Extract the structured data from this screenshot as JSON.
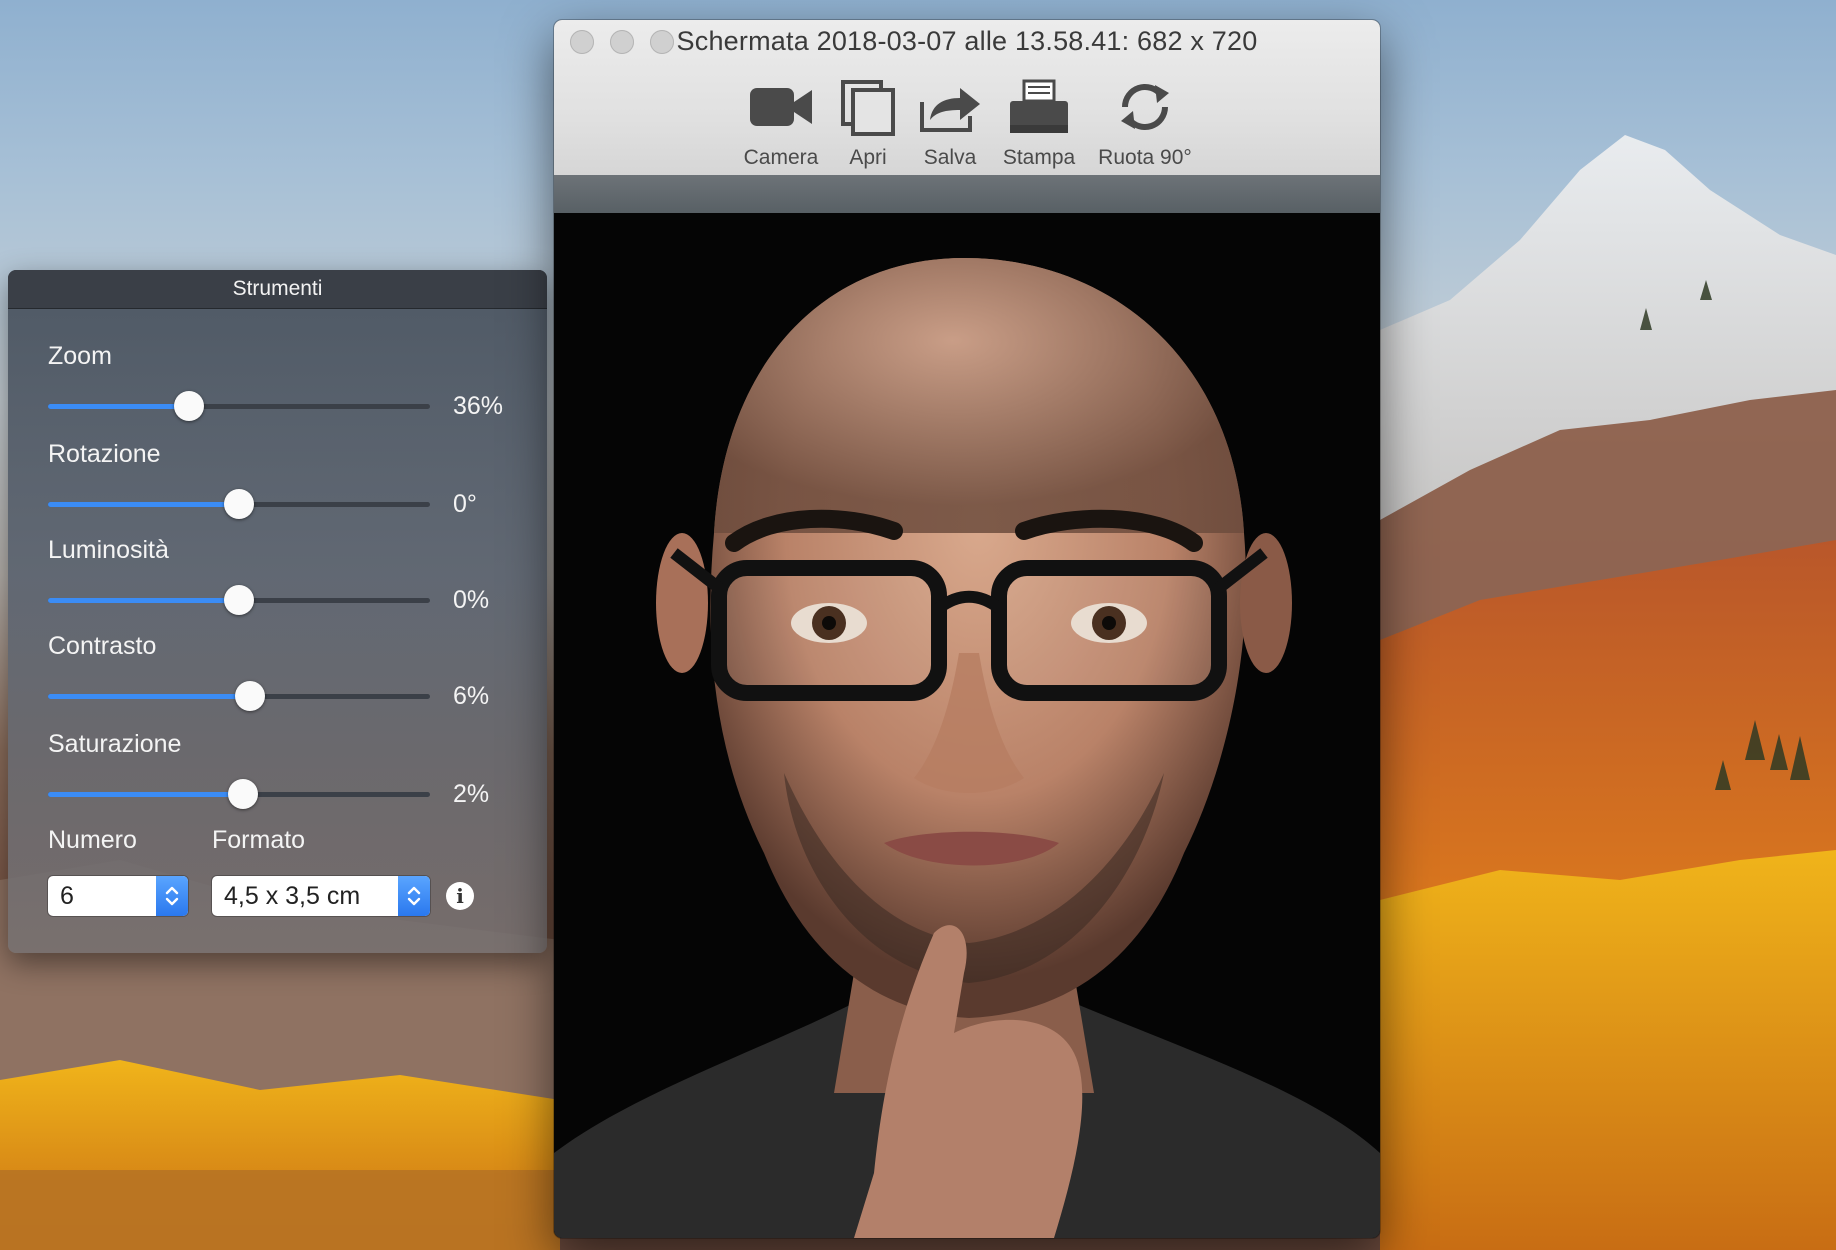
{
  "desktop": {
    "wallpaper": "mountain-autumn-wallpaper"
  },
  "preview_window": {
    "title": "Schermata 2018-03-07 alle 13.58.41: 682 x 720",
    "toolbar": [
      {
        "label": "Camera",
        "icon": "video-camera-icon"
      },
      {
        "label": "Apri",
        "icon": "open-icon"
      },
      {
        "label": "Salva",
        "icon": "share-icon"
      },
      {
        "label": "Stampa",
        "icon": "printer-icon"
      },
      {
        "label": "Ruota 90°",
        "icon": "rotate-icon"
      }
    ],
    "image": "portrait-photo"
  },
  "tools_panel": {
    "title": "Strumenti",
    "sliders": [
      {
        "label": "Zoom",
        "value_text": "36%",
        "position": 0.37
      },
      {
        "label": "Rotazione",
        "value_text": "0°",
        "position": 0.5
      },
      {
        "label": "Luminosità",
        "value_text": "0%",
        "position": 0.5
      },
      {
        "label": "Contrasto",
        "value_text": "6%",
        "position": 0.53
      },
      {
        "label": "Saturazione",
        "value_text": "2%",
        "position": 0.51
      }
    ],
    "numero": {
      "label": "Numero",
      "value": "6"
    },
    "formato": {
      "label": "Formato",
      "value": "4,5 x 3,5 cm"
    },
    "info_icon": "info-icon"
  },
  "colors": {
    "accent": "#3b8cf5",
    "panel_bg": "#4a5460",
    "titlebar": "#e3e3e3"
  }
}
